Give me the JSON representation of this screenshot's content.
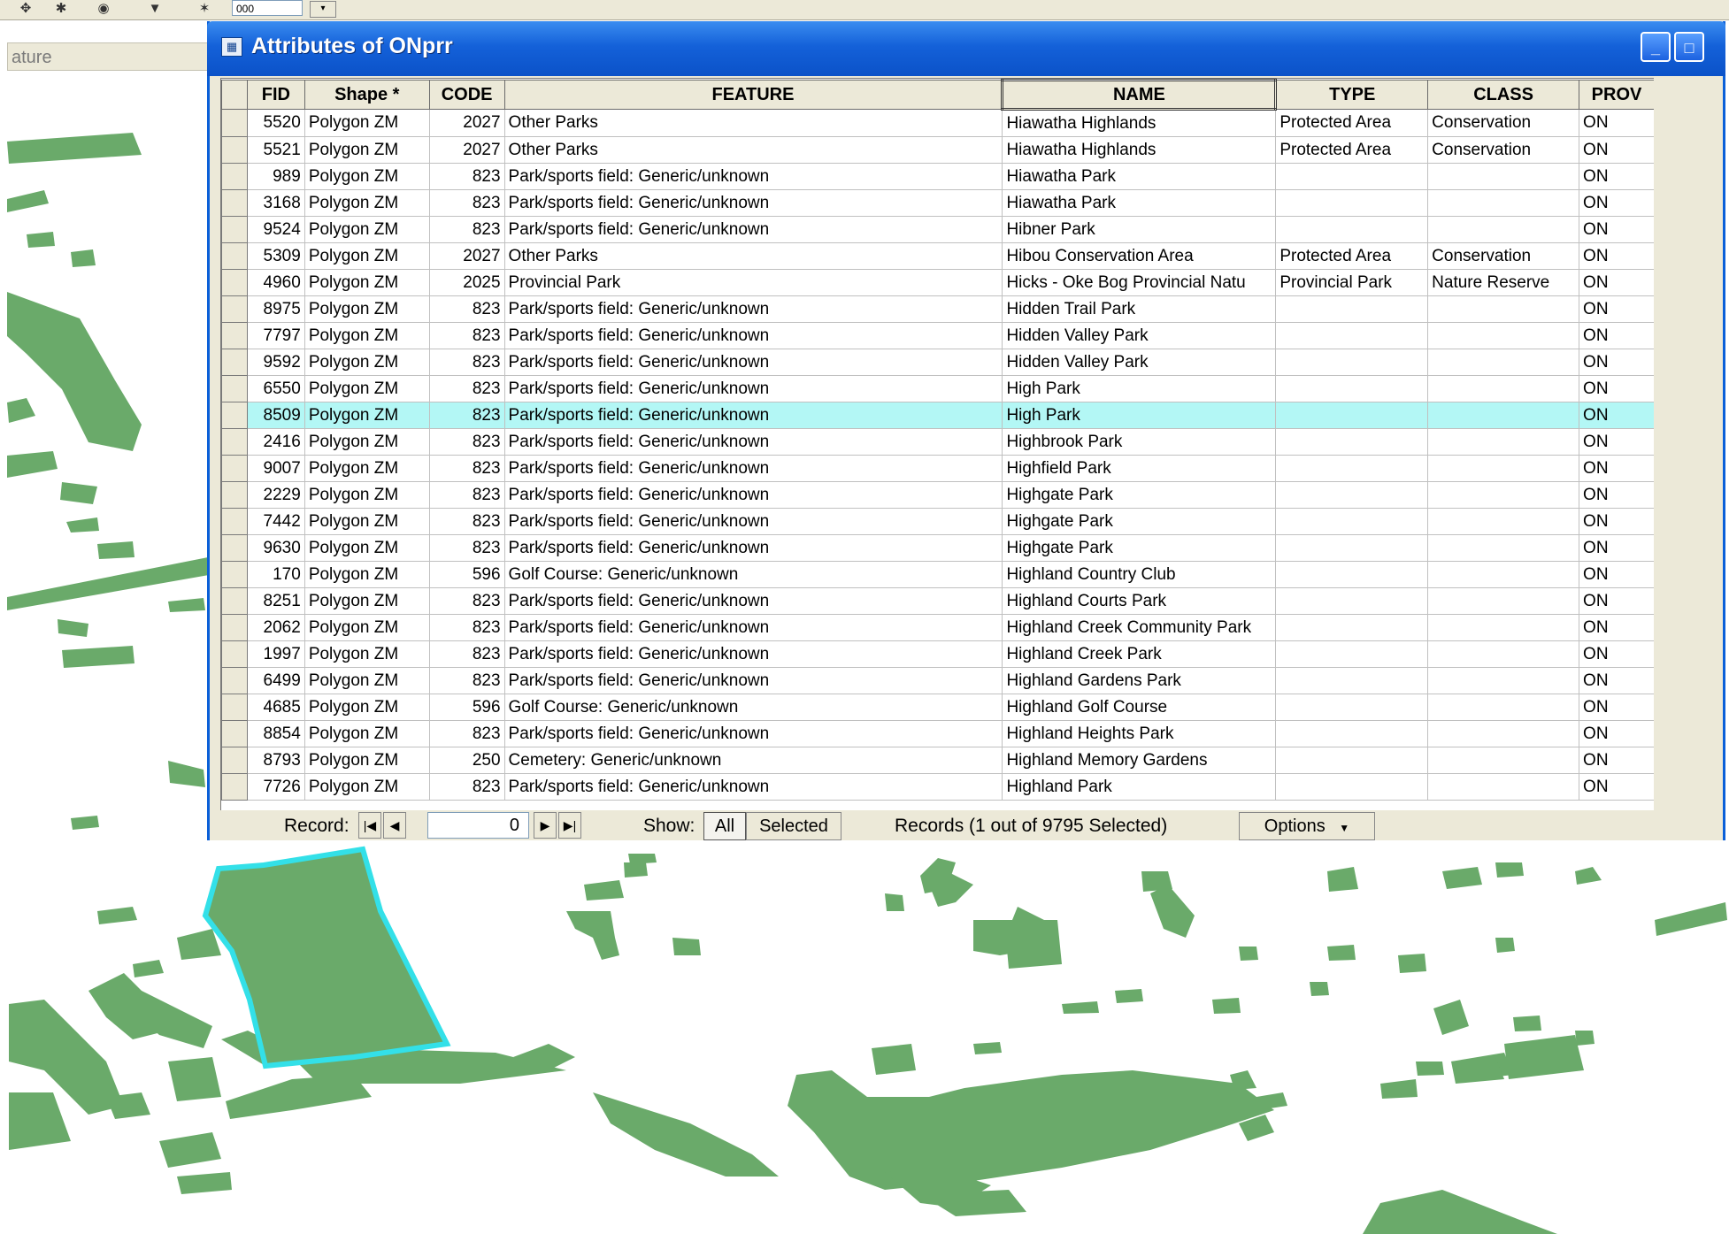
{
  "toolbar": {
    "side_tab_label": "ature",
    "scale_value": "000"
  },
  "window": {
    "title": "Attributes of ONprr",
    "minimize_glyph": "_",
    "maximize_glyph": "□"
  },
  "table": {
    "columns": [
      "FID",
      "Shape *",
      "CODE",
      "FEATURE",
      "NAME",
      "TYPE",
      "CLASS",
      "PROV"
    ],
    "rows": [
      [
        "5520",
        "Polygon ZM",
        "2027",
        "Other Parks",
        "Hiawatha Highlands",
        "Protected Area",
        "Conservation",
        "ON"
      ],
      [
        "5521",
        "Polygon ZM",
        "2027",
        "Other Parks",
        "Hiawatha Highlands",
        "Protected Area",
        "Conservation",
        "ON"
      ],
      [
        "989",
        "Polygon ZM",
        "823",
        "Park/sports field: Generic/unknown",
        "Hiawatha Park",
        "",
        "",
        "ON"
      ],
      [
        "3168",
        "Polygon ZM",
        "823",
        "Park/sports field: Generic/unknown",
        "Hiawatha Park",
        "",
        "",
        "ON"
      ],
      [
        "9524",
        "Polygon ZM",
        "823",
        "Park/sports field: Generic/unknown",
        "Hibner Park",
        "",
        "",
        "ON"
      ],
      [
        "5309",
        "Polygon ZM",
        "2027",
        "Other Parks",
        "Hibou Conservation Area",
        "Protected Area",
        "Conservation",
        "ON"
      ],
      [
        "4960",
        "Polygon ZM",
        "2025",
        "Provincial Park",
        "Hicks - Oke Bog Provincial Natu",
        "Provincial Park",
        "Nature Reserve",
        "ON"
      ],
      [
        "8975",
        "Polygon ZM",
        "823",
        "Park/sports field: Generic/unknown",
        "Hidden Trail Park",
        "",
        "",
        "ON"
      ],
      [
        "7797",
        "Polygon ZM",
        "823",
        "Park/sports field: Generic/unknown",
        "Hidden Valley Park",
        "",
        "",
        "ON"
      ],
      [
        "9592",
        "Polygon ZM",
        "823",
        "Park/sports field: Generic/unknown",
        "Hidden Valley Park",
        "",
        "",
        "ON"
      ],
      [
        "6550",
        "Polygon ZM",
        "823",
        "Park/sports field: Generic/unknown",
        "High Park",
        "",
        "",
        "ON"
      ],
      [
        "8509",
        "Polygon ZM",
        "823",
        "Park/sports field: Generic/unknown",
        "High Park",
        "",
        "",
        "ON"
      ],
      [
        "2416",
        "Polygon ZM",
        "823",
        "Park/sports field: Generic/unknown",
        "Highbrook Park",
        "",
        "",
        "ON"
      ],
      [
        "9007",
        "Polygon ZM",
        "823",
        "Park/sports field: Generic/unknown",
        "Highfield Park",
        "",
        "",
        "ON"
      ],
      [
        "2229",
        "Polygon ZM",
        "823",
        "Park/sports field: Generic/unknown",
        "Highgate Park",
        "",
        "",
        "ON"
      ],
      [
        "7442",
        "Polygon ZM",
        "823",
        "Park/sports field: Generic/unknown",
        "Highgate Park",
        "",
        "",
        "ON"
      ],
      [
        "9630",
        "Polygon ZM",
        "823",
        "Park/sports field: Generic/unknown",
        "Highgate Park",
        "",
        "",
        "ON"
      ],
      [
        "170",
        "Polygon ZM",
        "596",
        "Golf Course: Generic/unknown",
        "Highland Country Club",
        "",
        "",
        "ON"
      ],
      [
        "8251",
        "Polygon ZM",
        "823",
        "Park/sports field: Generic/unknown",
        "Highland Courts Park",
        "",
        "",
        "ON"
      ],
      [
        "2062",
        "Polygon ZM",
        "823",
        "Park/sports field: Generic/unknown",
        "Highland Creek Community Park",
        "",
        "",
        "ON"
      ],
      [
        "1997",
        "Polygon ZM",
        "823",
        "Park/sports field: Generic/unknown",
        "Highland Creek Park",
        "",
        "",
        "ON"
      ],
      [
        "6499",
        "Polygon ZM",
        "823",
        "Park/sports field: Generic/unknown",
        "Highland Gardens Park",
        "",
        "",
        "ON"
      ],
      [
        "4685",
        "Polygon ZM",
        "596",
        "Golf Course: Generic/unknown",
        "Highland Golf Course",
        "",
        "",
        "ON"
      ],
      [
        "8854",
        "Polygon ZM",
        "823",
        "Park/sports field: Generic/unknown",
        "Highland Heights Park",
        "",
        "",
        "ON"
      ],
      [
        "8793",
        "Polygon ZM",
        "250",
        "Cemetery: Generic/unknown",
        "Highland Memory Gardens",
        "",
        "",
        "ON"
      ],
      [
        "7726",
        "Polygon ZM",
        "823",
        "Park/sports field: Generic/unknown",
        "Highland Park",
        "",
        "",
        "ON"
      ]
    ],
    "highlighted_row_fid": "8509"
  },
  "footer": {
    "record_label": "Record:",
    "record_value": "0",
    "show_label": "Show:",
    "all_label": "All",
    "selected_label": "Selected",
    "records_status": "Records (1 out of 9795 Selected)",
    "options_label": "Options"
  },
  "colors": {
    "map_fill": "#6aaa6a",
    "selection_outline": "#33e0e8",
    "highlight_row": "#b3f7f5",
    "title_bar": "#0b52c8"
  }
}
